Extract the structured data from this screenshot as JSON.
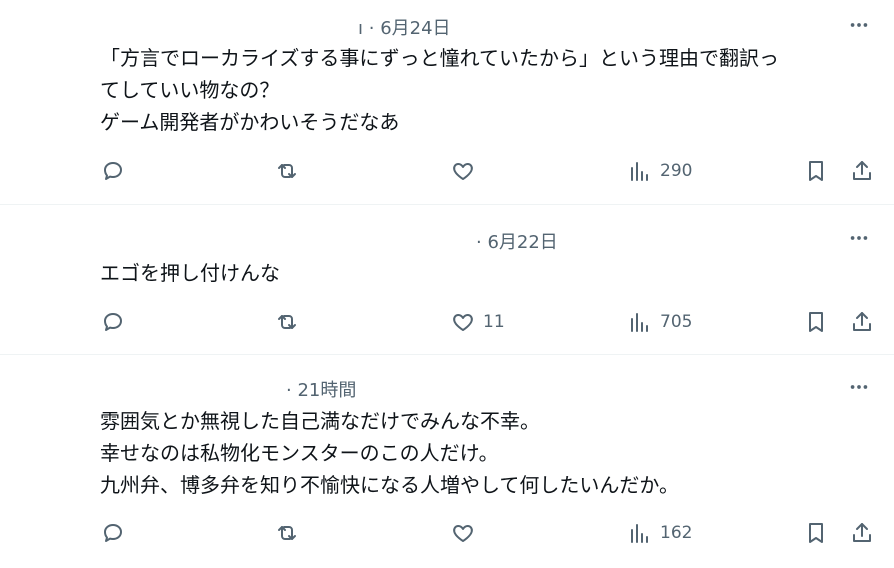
{
  "tweets": [
    {
      "meta": "· 6月24日",
      "lines": [
        "「方言でローカライズする事にずっと憧れていたから」という理由で翻訳っ",
        "てしていい物なの？",
        "ゲーム開発者がかわいそうだなあ"
      ],
      "likes": "",
      "views": "290"
    },
    {
      "meta": "· 6月22日",
      "lines": [
        "エゴを押し付けんな"
      ],
      "likes": "11",
      "views": "705"
    },
    {
      "meta": "· 21時間",
      "lines": [
        "雰囲気とか無視した自己満なだけでみんな不幸。",
        "幸せなのは私物化モンスターのこの人だけ。",
        "九州弁、博多弁を知り不愉快になる人増やして何したいんだか。"
      ],
      "likes": "",
      "views": "162"
    }
  ],
  "icons": {
    "reply": "reply-icon",
    "retweet": "retweet-icon",
    "like": "heart-icon",
    "views": "views-icon",
    "bookmark": "bookmark-icon",
    "share": "share-icon",
    "more": "more-icon"
  },
  "colors": {
    "text": "#0f1419",
    "secondary": "#536471",
    "divider": "#eff3f4"
  }
}
